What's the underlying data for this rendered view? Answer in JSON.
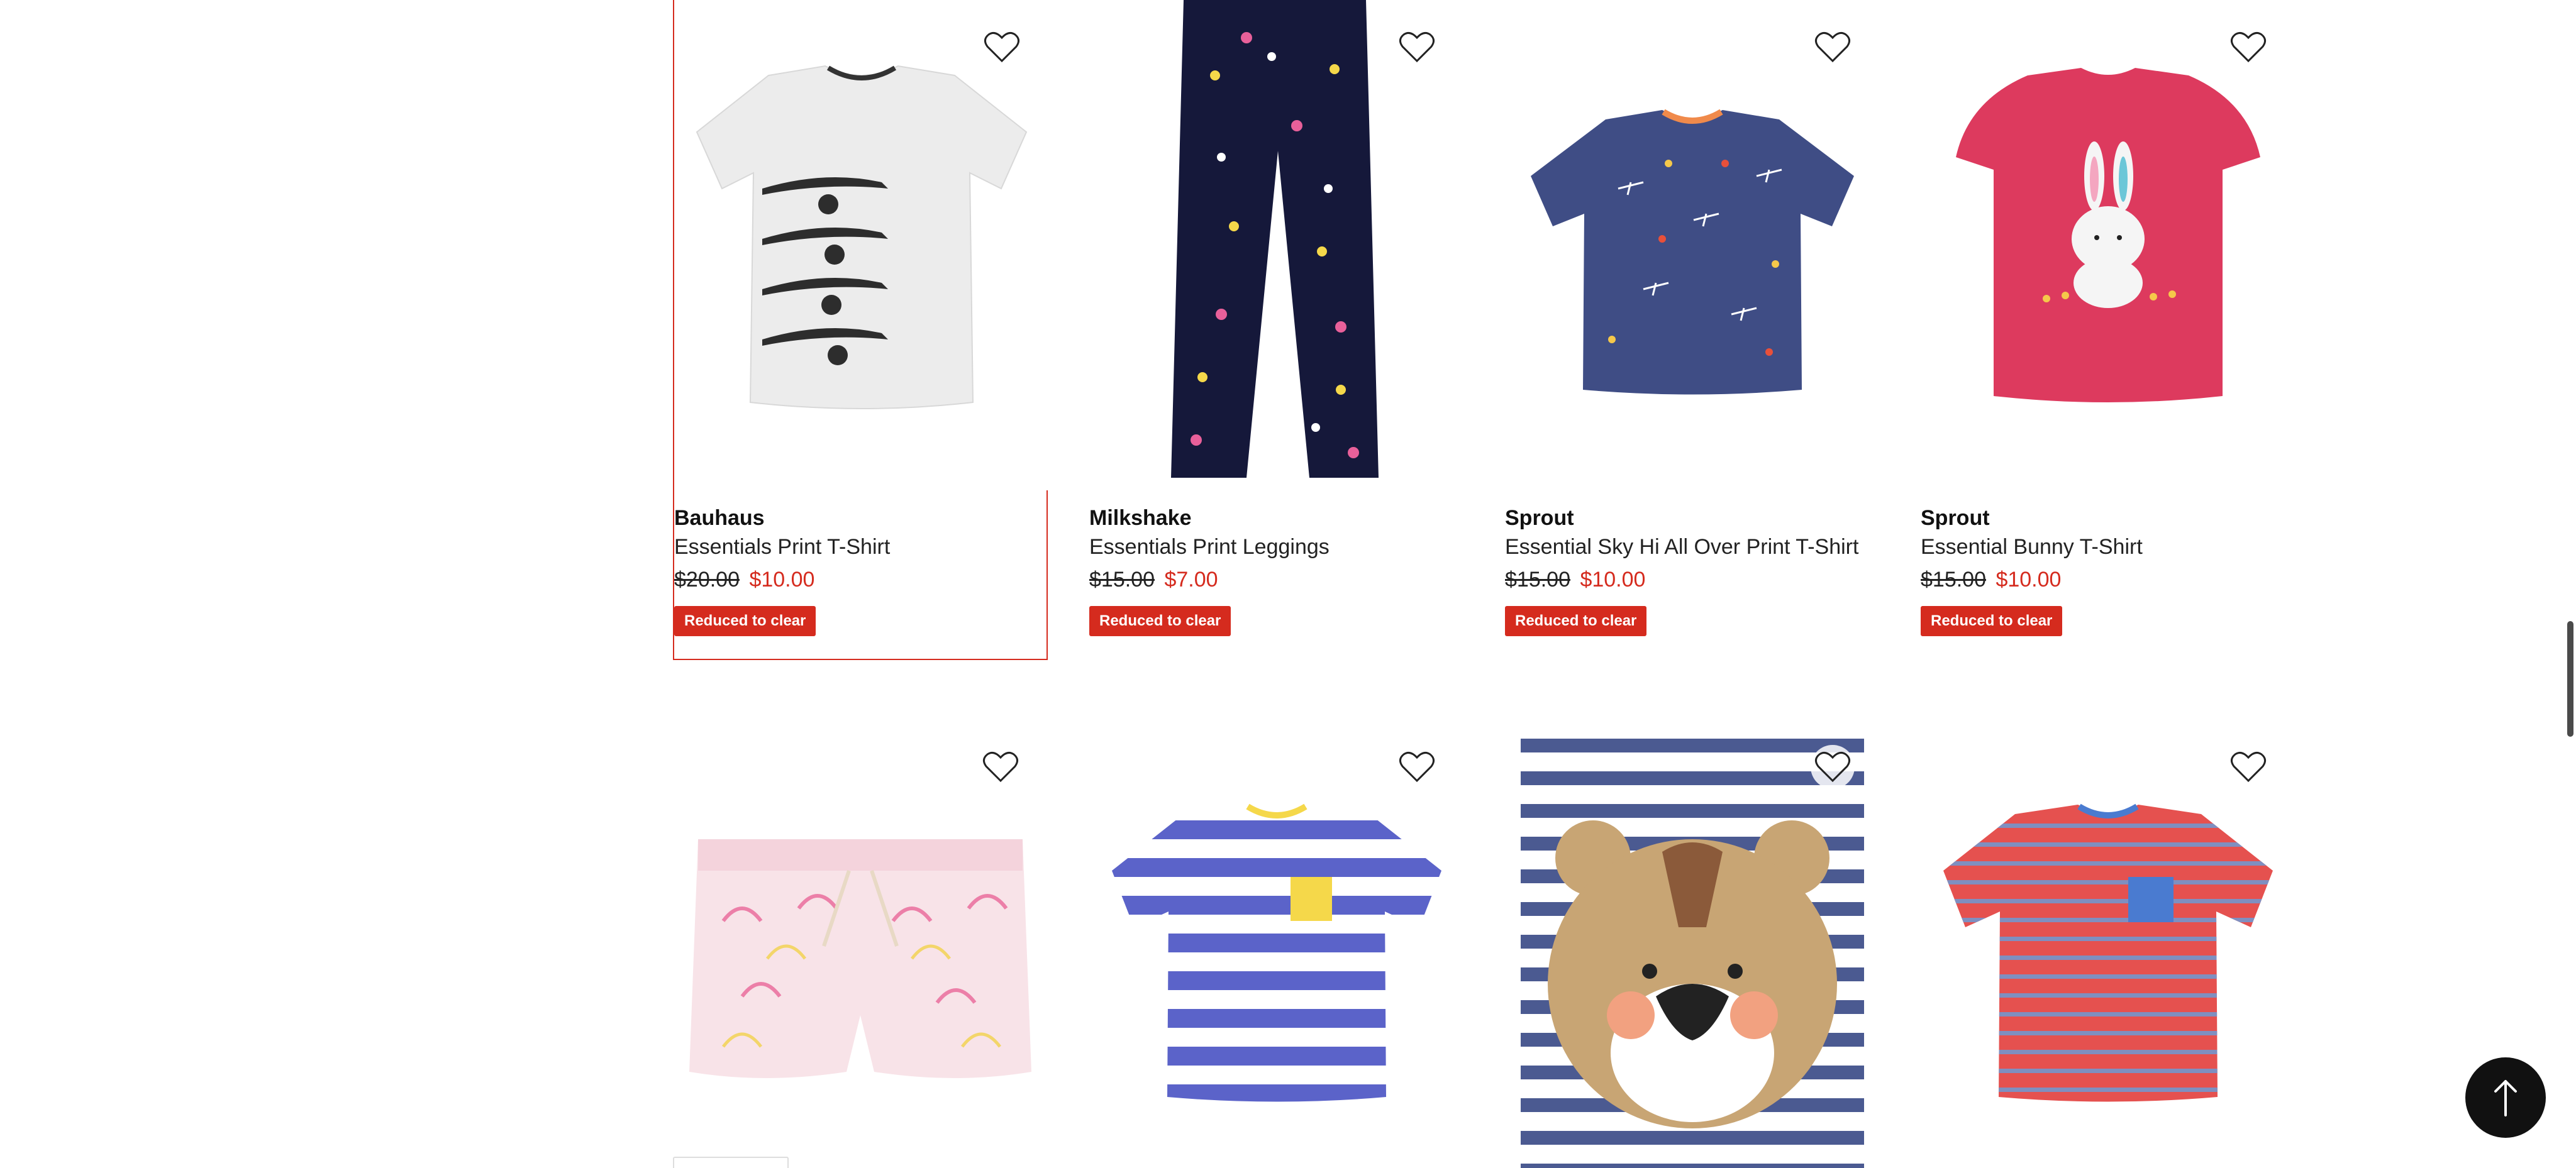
{
  "products_row1": [
    {
      "brand": "Bauhaus",
      "name": "Essentials Print T-Shirt",
      "was_price": "$20.00",
      "now_price": "$10.00",
      "badge": "Reduced to clear",
      "image_icon": "tshirt-skateboard-icon"
    },
    {
      "brand": "Milkshake",
      "name": "Essentials Print Leggings",
      "was_price": "$15.00",
      "now_price": "$7.00",
      "badge": "Reduced to clear",
      "image_icon": "leggings-icon"
    },
    {
      "brand": "Sprout",
      "name": "Essential Sky Hi All Over Print T-Shirt",
      "was_price": "$15.00",
      "now_price": "$10.00",
      "badge": "Reduced to clear",
      "image_icon": "tshirt-planes-icon"
    },
    {
      "brand": "Sprout",
      "name": "Essential Bunny T-Shirt",
      "was_price": "$15.00",
      "now_price": "$10.00",
      "badge": "Reduced to clear",
      "image_icon": "tshirt-bunny-icon"
    }
  ],
  "products_row2": [
    {
      "image_icon": "shorts-rainbow-icon"
    },
    {
      "image_icon": "tshirt-stripe-blue-icon"
    },
    {
      "image_icon": "tshirt-bear-icon"
    },
    {
      "image_icon": "tshirt-stripe-red-icon"
    }
  ],
  "colors": {
    "accent": "#d52b1e",
    "wishlist": "#222222",
    "scroll_button": "#111111"
  },
  "icons": {
    "wishlist": "heart-outline-icon",
    "scroll_top": "arrow-up-icon"
  }
}
